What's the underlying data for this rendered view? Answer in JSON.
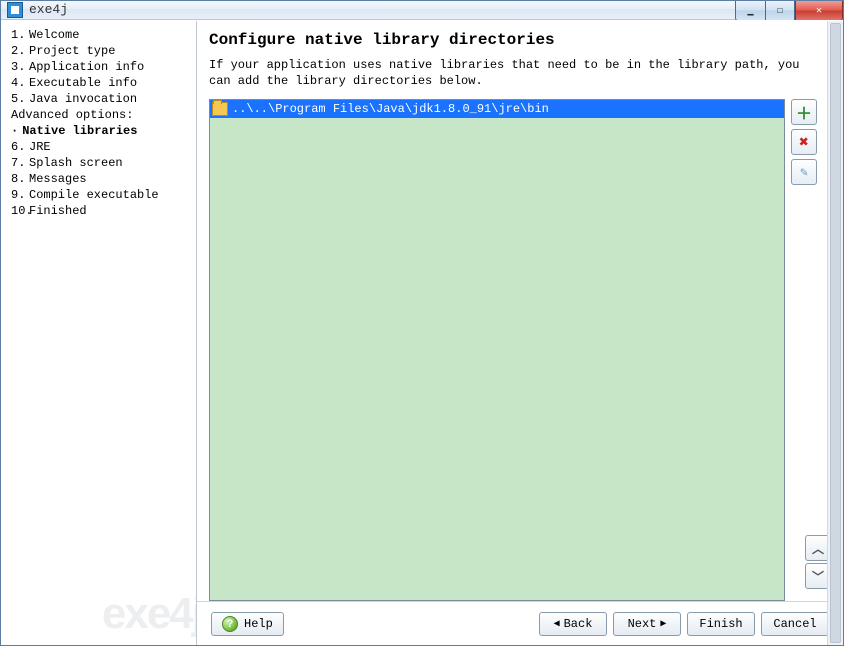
{
  "window": {
    "title": "exe4j"
  },
  "nav": {
    "items": [
      {
        "num": "1.",
        "label": "Welcome"
      },
      {
        "num": "2.",
        "label": "Project type"
      },
      {
        "num": "3.",
        "label": "Application info"
      },
      {
        "num": "4.",
        "label": "Executable info"
      },
      {
        "num": "5.",
        "label": "Java invocation"
      },
      {
        "num": "6.",
        "label": "JRE"
      },
      {
        "num": "7.",
        "label": "Splash screen"
      },
      {
        "num": "8.",
        "label": "Messages"
      },
      {
        "num": "9.",
        "label": "Compile executable"
      },
      {
        "num": "10.",
        "label": "Finished"
      }
    ],
    "advanced_header": "Advanced options:",
    "advanced_current": "Native libraries"
  },
  "page": {
    "title": "Configure native library directories",
    "description": "If your application uses native libraries that need to be in the library path, you can add the library directories below."
  },
  "dirs": {
    "entries": [
      "..\\..\\Program Files\\Java\\jdk1.8.0_91\\jre\\bin"
    ]
  },
  "buttons": {
    "help": "Help",
    "back": "Back",
    "next": "Next",
    "finish": "Finish",
    "cancel": "Cancel"
  },
  "watermark": "exe4j"
}
